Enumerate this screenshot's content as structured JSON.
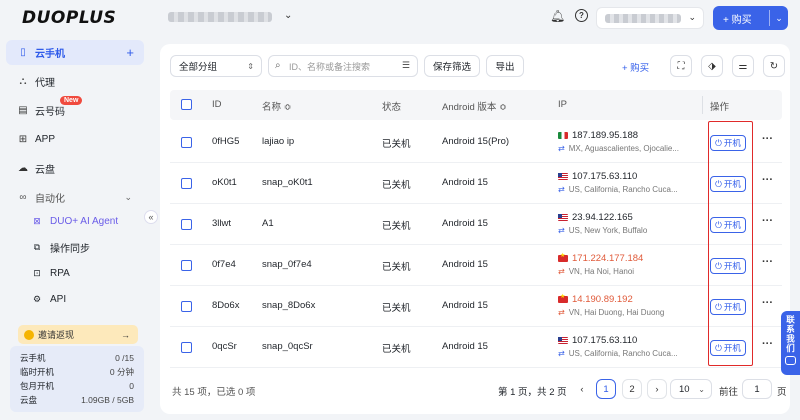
{
  "brand": {
    "logo": "DUOPLUS"
  },
  "sidebar": {
    "items": [
      {
        "label": "云手机",
        "icon": "phone-icon",
        "active": true
      },
      {
        "label": "代理",
        "icon": "network-icon"
      },
      {
        "label": "云号码",
        "icon": "number-icon",
        "badge": "New"
      },
      {
        "label": "APP",
        "icon": "apps-grid-icon"
      },
      {
        "label": "云盘",
        "icon": "cloud-icon"
      }
    ],
    "group": {
      "label": "自动化",
      "icon": "infinity-icon"
    },
    "sub_items": [
      {
        "label": "DUO+ AI Agent",
        "icon": "ai-agent-icon"
      },
      {
        "label": "操作同步",
        "icon": "sync-icon"
      },
      {
        "label": "RPA",
        "icon": "robot-icon"
      },
      {
        "label": "API",
        "icon": "api-icon"
      }
    ],
    "invite": {
      "label": "邀请返现",
      "arrow": "→"
    },
    "quota": [
      {
        "label": "云手机",
        "value": "0 /15"
      },
      {
        "label": "临时开机",
        "value": "0 分钟"
      },
      {
        "label": "包月开机",
        "value": "0"
      },
      {
        "label": "云盘",
        "value": "1.09GB / 5GB"
      }
    ]
  },
  "topbar": {
    "buy_label": "+ 购买"
  },
  "toolbar": {
    "group_select": "全部分组",
    "search_placeholder": "ID、名称或备注搜索",
    "save_filter": "保存筛选",
    "export": "导出",
    "buy": "+ 购买"
  },
  "table": {
    "headers": {
      "id": "ID",
      "name": "名称 ≎",
      "status": "状态",
      "android": "Android 版本 ≎",
      "ip": "IP",
      "ops": "操作"
    },
    "on_label": "开机",
    "rows": [
      {
        "id": "0fHG5",
        "name": "lajiao ip",
        "status": "已关机",
        "android": "Android 15(Pro)",
        "ip": "187.189.95.188",
        "location": "MX, Aguascalientes, Ojocalie...",
        "flag": "mx",
        "ip_warn": false
      },
      {
        "id": "oK0t1",
        "name": "snap_oK0t1",
        "status": "已关机",
        "android": "Android 15",
        "ip": "107.175.63.110",
        "location": "US, California, Rancho Cuca...",
        "flag": "us",
        "ip_warn": false
      },
      {
        "id": "3llwt",
        "name": "A1",
        "status": "已关机",
        "android": "Android 15",
        "ip": "23.94.122.165",
        "location": "US, New York, Buffalo",
        "flag": "us",
        "ip_warn": false
      },
      {
        "id": "0f7e4",
        "name": "snap_0f7e4",
        "status": "已关机",
        "android": "Android 15",
        "ip": "171.224.177.184",
        "location": "VN, Ha Noi, Hanoi",
        "flag": "vn",
        "ip_warn": true
      },
      {
        "id": "8Do6x",
        "name": "snap_8Do6x",
        "status": "已关机",
        "android": "Android 15",
        "ip": "14.190.89.192",
        "location": "VN, Hai Duong, Hai Duong",
        "flag": "vn",
        "ip_warn": true
      },
      {
        "id": "0qcSr",
        "name": "snap_0qcSr",
        "status": "已关机",
        "android": "Android 15",
        "ip": "107.175.63.110",
        "location": "US, California, Rancho Cuca...",
        "flag": "us",
        "ip_warn": false
      }
    ]
  },
  "footer": {
    "summary": "共 15 项，已选 0 项",
    "page_info": "第 1 页，共 2 页",
    "pages": [
      "1",
      "2"
    ],
    "page_size": "10",
    "goto_label": "前往",
    "goto_value": "1",
    "page_suffix": "页"
  },
  "contact": {
    "label": "联系我们"
  },
  "colors": {
    "accent": "#3a63e8",
    "warn": "#e05a3a",
    "highlight_box": "#e02a2a"
  }
}
